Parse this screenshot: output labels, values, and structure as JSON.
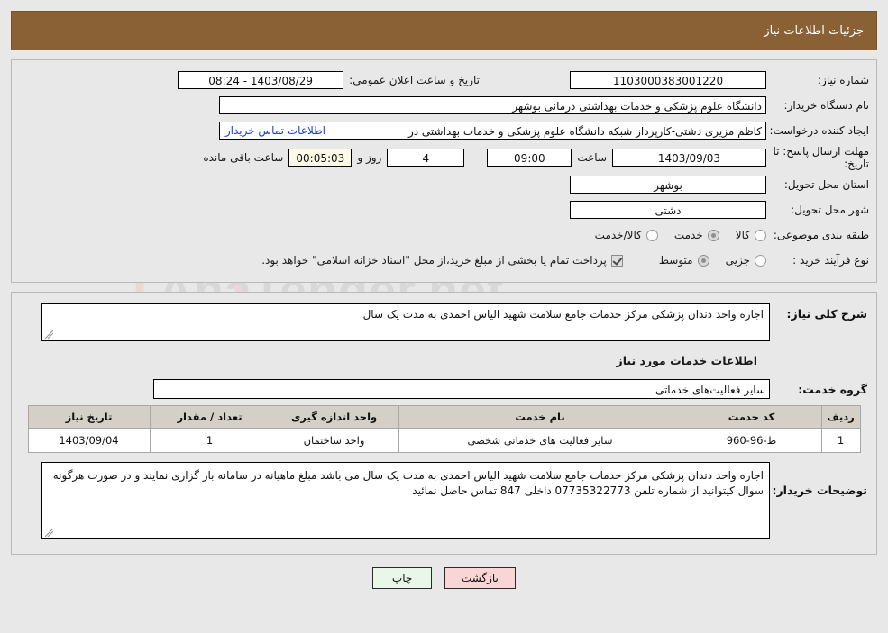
{
  "header": {
    "title": "جزئیات اطلاعات نیاز"
  },
  "top": {
    "need_number_label": "شماره نیاز:",
    "need_number_value": "1103000383001220",
    "announce_datetime_label": "تاریخ و ساعت اعلان عمومی:",
    "announce_datetime_value": "1403/08/29 - 08:24",
    "buyer_org_label": "نام دستگاه خریدار:",
    "buyer_org_value": "دانشگاه علوم پزشکی و خدمات بهداشتی درمانی بوشهر",
    "requester_label": "ایجاد کننده درخواست:",
    "requester_value": "کاظم مزیری دشتی-کارپرداز شبکه دانشگاه علوم پزشکی و خدمات بهداشتی در",
    "buyer_contact_link": "اطلاعات تماس خریدار",
    "deadline_label": "مهلت ارسال پاسخ: تا تاریخ:",
    "deadline_date": "1403/09/03",
    "time_label": "ساعت",
    "deadline_time": "09:00",
    "days_remaining": "4",
    "days_unit_label": "روز و",
    "countdown": "00:05:03",
    "countdown_unit_label": "ساعت باقی مانده",
    "province_label": "استان محل تحویل:",
    "province_value": "بوشهر",
    "city_label": "شهر محل تحویل:",
    "city_value": "دشتی",
    "category_label": "طبقه بندی موضوعی:",
    "category_options": [
      {
        "label": "کالا",
        "selected": false
      },
      {
        "label": "خدمت",
        "selected": true
      },
      {
        "label": "کالا/خدمت",
        "selected": false
      }
    ],
    "purchase_type_label": "نوع فرآیند خرید :",
    "purchase_type_options": [
      {
        "label": "جزیی",
        "selected": false
      },
      {
        "label": "متوسط",
        "selected": true
      }
    ],
    "treasury_checkbox_label": "پرداخت تمام یا بخشی از مبلغ خرید،از محل \"اسناد خزانه اسلامی\" خواهد بود.",
    "treasury_checked": true
  },
  "mid": {
    "general_desc_label": "شرح کلی نیاز:",
    "general_desc_value": "اجاره واحد دندان پزشکی مرکز خدمات جامع سلامت شهید الیاس احمدی به مدت یک سال",
    "services_section_title": "اطلاعات خدمات مورد نیاز",
    "service_group_label": "گروه خدمت:",
    "service_group_value": "سایر فعالیت‌های خدماتی",
    "table": {
      "columns": [
        "ردیف",
        "کد خدمت",
        "نام خدمت",
        "واحد اندازه گیری",
        "تعداد / مقدار",
        "تاریخ نیاز"
      ],
      "rows": [
        [
          "1",
          "ط-96-960",
          "سایر فعالیت های خدماتی شخصی",
          "واحد ساختمان",
          "1",
          "1403/09/04"
        ]
      ]
    },
    "buyer_notes_label": "توضیحات خریدار:",
    "buyer_notes_value": "اجاره واحد دندان پزشکی مرکز خدمات جامع سلامت شهید الیاس احمدی به مدت یک سال  می باشد مبلغ ماهیانه در سامانه بار گزاری نمایند و در صورت هرگونه سوال کیتوانید از شماره تلفن 07735322773 داخلی 847 تماس حاصل نمائید"
  },
  "footer": {
    "print_label": "چاپ",
    "back_label": "بازگشت"
  },
  "watermark": {
    "text": "AnaTender.net"
  },
  "colors": {
    "header_bg": "#8a6134",
    "link": "#1b3fd0",
    "print_btn": "#e9f7e9",
    "back_btn": "#fad5d5",
    "countdown_bg": "#fbfbe8"
  }
}
